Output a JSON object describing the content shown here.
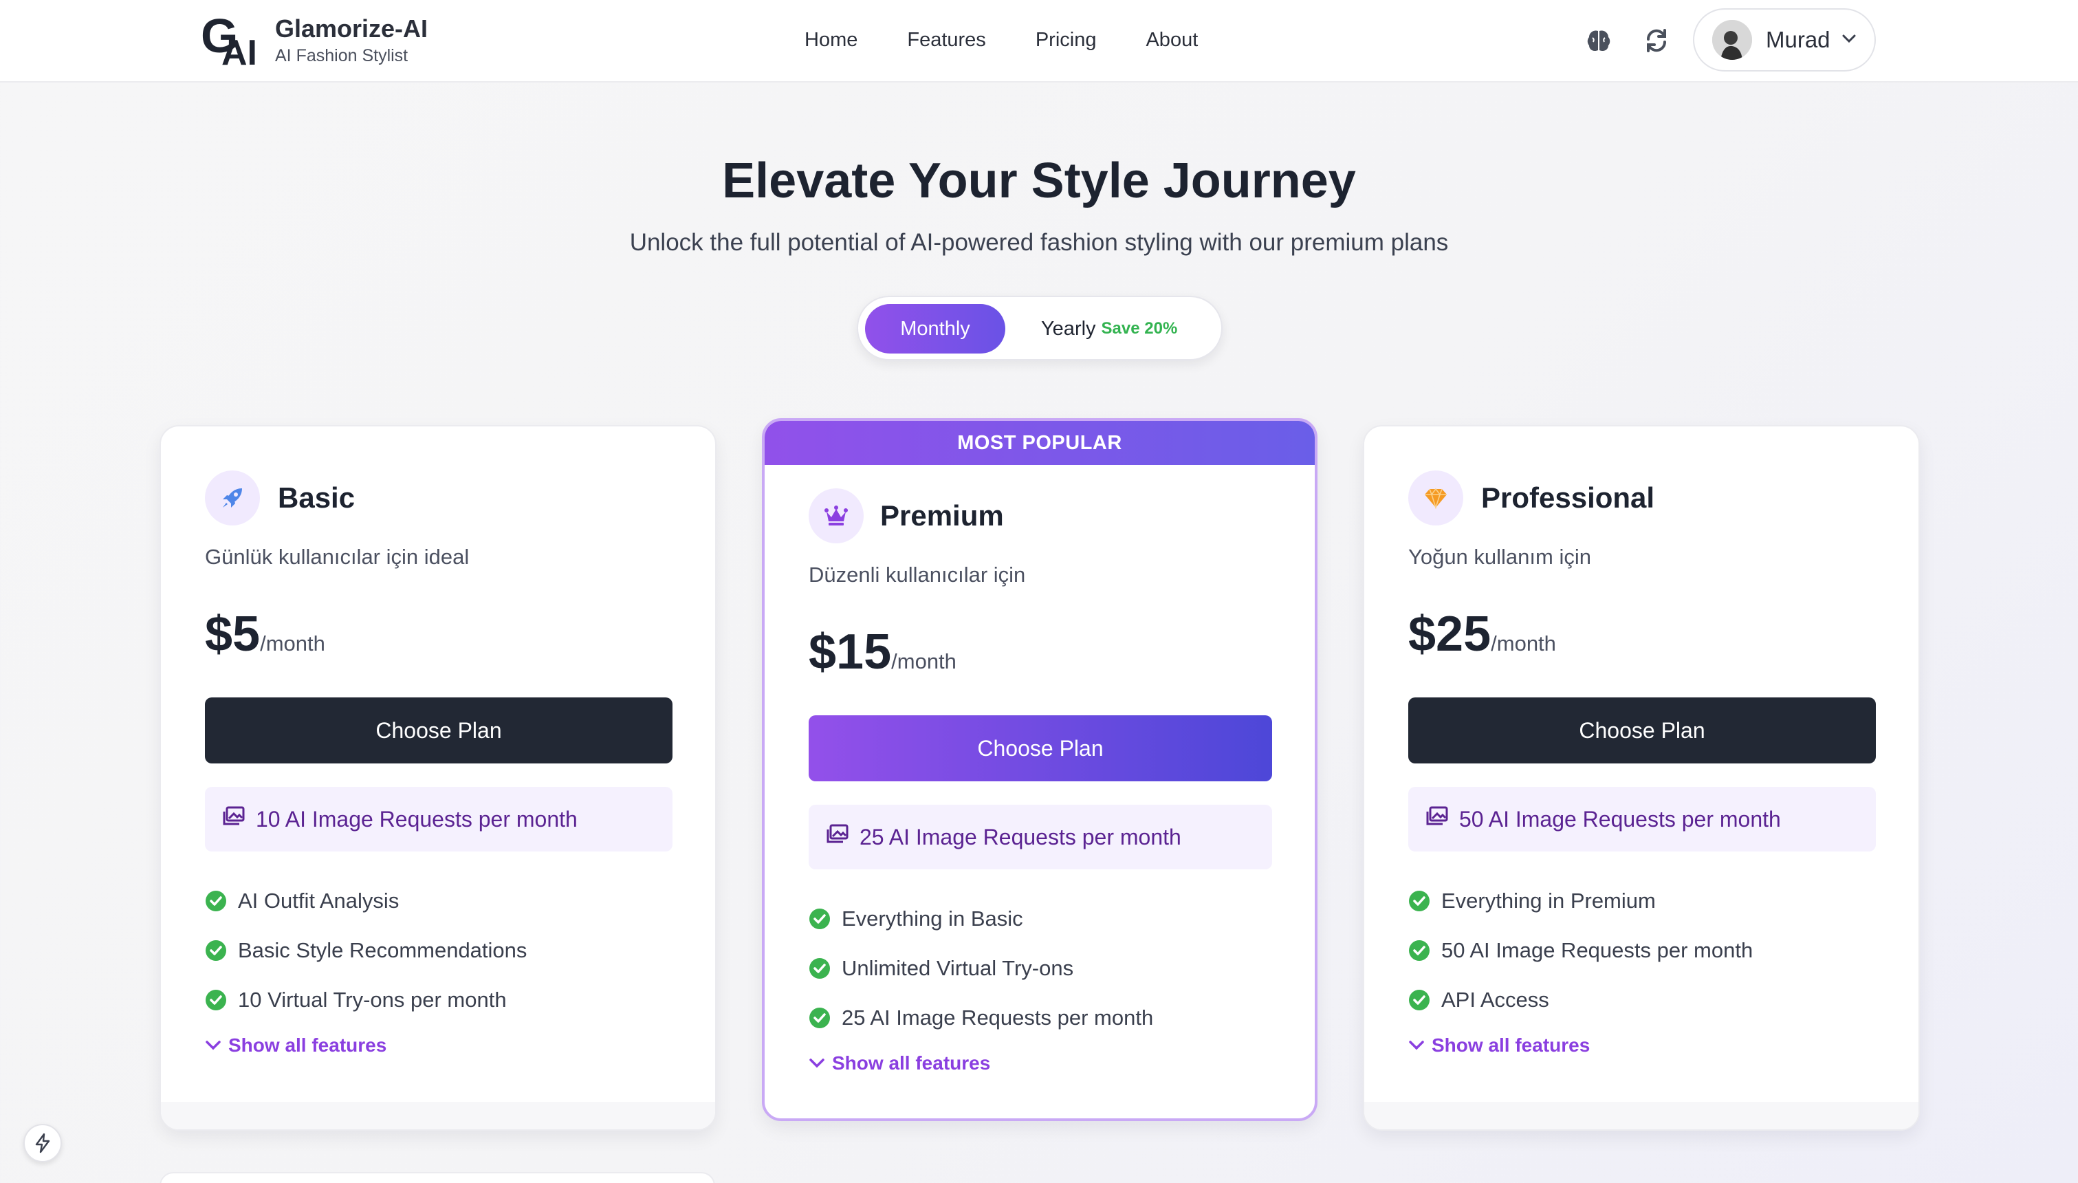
{
  "brand": {
    "logo_text": "GAI",
    "name": "Glamorize-AI",
    "tagline": "AI Fashion Stylist"
  },
  "nav": {
    "links": [
      {
        "label": "Home"
      },
      {
        "label": "Features"
      },
      {
        "label": "Pricing"
      },
      {
        "label": "About"
      }
    ],
    "icons": [
      "brain-icon",
      "refresh-icon"
    ],
    "user": {
      "name": "Murad"
    }
  },
  "hero": {
    "title": "Elevate Your Style Journey",
    "subtitle": "Unlock the full potential of AI-powered fashion styling with our premium plans"
  },
  "billing_toggle": {
    "monthly": "Monthly",
    "yearly": "Yearly",
    "yearly_badge": "Save 20%",
    "selected": "Monthly"
  },
  "plans": [
    {
      "name": "Basic",
      "icon": "rocket-icon",
      "description": "Günlük kullanıcılar için ideal",
      "price": "$5",
      "period": "/month",
      "cta": "Choose Plan",
      "quota": "10 AI Image Requests per month",
      "features": [
        "AI Outfit Analysis",
        "Basic Style Recommendations",
        "10 Virtual Try-ons per month"
      ],
      "show_all": "Show all features"
    },
    {
      "name": "Premium",
      "icon": "crown-icon",
      "badge": "MOST POPULAR",
      "description": "Düzenli kullanıcılar için",
      "price": "$15",
      "period": "/month",
      "cta": "Choose Plan",
      "quota": "25 AI Image Requests per month",
      "features": [
        "Everything in Basic",
        "Unlimited Virtual Try-ons",
        "25 AI Image Requests per month"
      ],
      "show_all": "Show all features"
    },
    {
      "name": "Professional",
      "icon": "gem-icon",
      "description": "Yoğun kullanım için",
      "price": "$25",
      "period": "/month",
      "cta": "Choose Plan",
      "quota": "50 AI Image Requests per month",
      "features": [
        "Everything in Premium",
        "50 AI Image Requests per month",
        "API Access"
      ],
      "show_all": "Show all features"
    }
  ],
  "colors": {
    "accent_purple": "#9151ea",
    "accent_indigo": "#4d47d8",
    "dark_button": "#222834",
    "check_green": "#3bb34f",
    "save_green": "#33b350",
    "quota_text": "#5b2392",
    "gem_orange": "#f59a23",
    "rocket_blue": "#4f86e8"
  }
}
